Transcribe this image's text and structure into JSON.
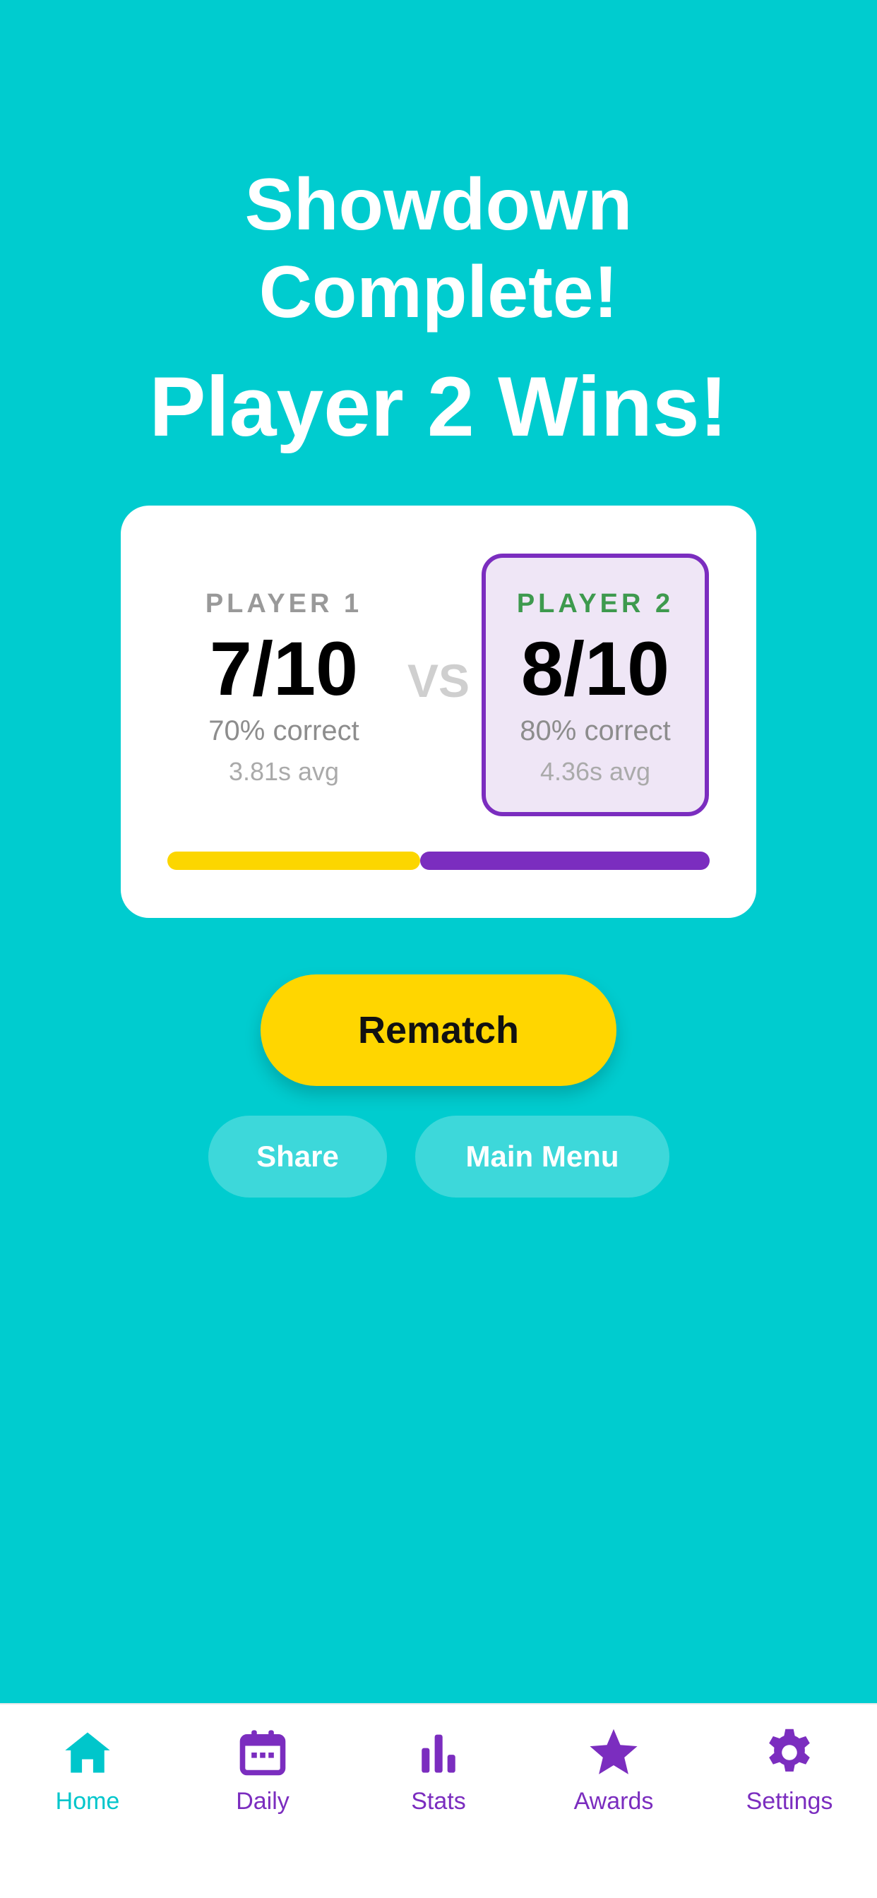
{
  "header": {
    "title_line1": "Showdown",
    "title_line2": "Complete!",
    "winner": "Player 2 Wins!"
  },
  "result": {
    "vs": "VS",
    "player1": {
      "name": "PLAYER 1",
      "score": "7/10",
      "correct": "70% correct",
      "avg": "3.81s avg"
    },
    "player2": {
      "name": "PLAYER 2",
      "score": "8/10",
      "correct": "80% correct",
      "avg": "4.36s avg"
    },
    "progress": {
      "player1_share": 0.4667,
      "player2_share": 0.5333
    }
  },
  "actions": {
    "rematch": "Rematch",
    "share": "Share",
    "main_menu": "Main Menu"
  },
  "tabbar": {
    "items": [
      {
        "label": "Home",
        "icon": "home-icon",
        "active": true
      },
      {
        "label": "Daily",
        "icon": "calendar-icon",
        "active": false
      },
      {
        "label": "Stats",
        "icon": "stats-icon",
        "active": false
      },
      {
        "label": "Awards",
        "icon": "star-icon",
        "active": false
      },
      {
        "label": "Settings",
        "icon": "gear-icon",
        "active": false
      }
    ]
  },
  "colors": {
    "background": "#00CCCF",
    "accent_yellow": "#FFD600",
    "accent_purple": "#7B2DBF",
    "winner_green": "#3E9A4E",
    "tab_active": "#00C6CB"
  }
}
